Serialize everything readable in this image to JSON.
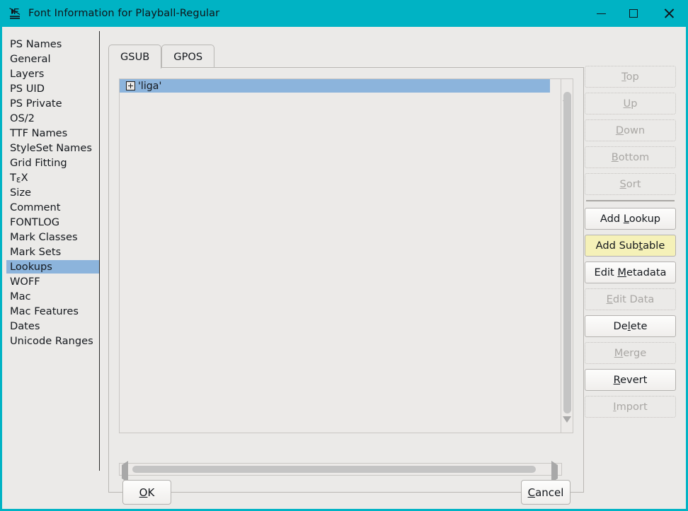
{
  "window": {
    "title": "Font Information for Playball-Regular",
    "icon": "fontforge-icon",
    "accent_color": "#00b3c4",
    "background_color": "#ebeae8",
    "controls": {
      "minimize": "minimize-icon",
      "maximize": "maximize-icon",
      "close": "close-icon"
    }
  },
  "sidebar": {
    "selected": "Lookups",
    "selection_color": "#8cb4dc",
    "items": [
      {
        "label": "PS Names"
      },
      {
        "label": "General"
      },
      {
        "label": "Layers"
      },
      {
        "label": "PS UID"
      },
      {
        "label": "PS Private"
      },
      {
        "label": "OS/2"
      },
      {
        "label": "TTF Names"
      },
      {
        "label": "StyleSet Names"
      },
      {
        "label": "Grid Fitting"
      },
      {
        "label": "TeX",
        "special": "tex-logo"
      },
      {
        "label": "Size"
      },
      {
        "label": "Comment"
      },
      {
        "label": "FONTLOG"
      },
      {
        "label": "Mark Classes"
      },
      {
        "label": "Mark Sets"
      },
      {
        "label": "Lookups"
      },
      {
        "label": "WOFF"
      },
      {
        "label": "Mac"
      },
      {
        "label": "Mac Features"
      },
      {
        "label": "Dates"
      },
      {
        "label": "Unicode Ranges"
      }
    ]
  },
  "main": {
    "tabs": [
      {
        "label": "GSUB",
        "active": true
      },
      {
        "label": "GPOS",
        "active": false
      }
    ],
    "lookup_list": {
      "rows": [
        {
          "label": "'liga'",
          "expander": "plus-box-icon",
          "selected": true
        }
      ]
    },
    "scrollbars": {
      "vertical": {
        "up": "scroll-up-arrow",
        "down": "scroll-down-arrow"
      },
      "horizontal": {
        "left": "scroll-left-arrow",
        "right": "scroll-right-arrow"
      }
    }
  },
  "buttons": {
    "order": [
      {
        "label": "Top",
        "mnemonic": "T",
        "rest": "op",
        "pre": "",
        "state": "disabled"
      },
      {
        "label": "Up",
        "mnemonic": "U",
        "rest": "p",
        "pre": "",
        "state": "disabled"
      },
      {
        "label": "Down",
        "mnemonic": "D",
        "rest": "own",
        "pre": "",
        "state": "disabled"
      },
      {
        "label": "Bottom",
        "mnemonic": "B",
        "rest": "ottom",
        "pre": "",
        "state": "disabled"
      },
      {
        "label": "Sort",
        "mnemonic": "S",
        "rest": "ort",
        "pre": "",
        "state": "disabled"
      }
    ],
    "actions": [
      {
        "label": "Add Lookup",
        "pre": "Add ",
        "mnemonic": "L",
        "rest": "ookup",
        "state": "enabled"
      },
      {
        "label": "Add Subtable",
        "pre": "Add Sub",
        "mnemonic": "t",
        "rest": "able",
        "state": "hover"
      },
      {
        "label": "Edit Metadata",
        "pre": "Edit ",
        "mnemonic": "M",
        "rest": "etadata",
        "state": "enabled"
      },
      {
        "label": "Edit Data",
        "pre": "",
        "mnemonic": "E",
        "rest": "dit Data",
        "state": "disabled"
      },
      {
        "label": "Delete",
        "pre": "De",
        "mnemonic": "l",
        "rest": "ete",
        "state": "enabled"
      },
      {
        "label": "Merge",
        "pre": "",
        "mnemonic": "M",
        "rest": "erge",
        "state": "disabled"
      },
      {
        "label": "Revert",
        "pre": "",
        "mnemonic": "R",
        "rest": "evert",
        "state": "enabled"
      },
      {
        "label": "Import",
        "pre": "",
        "mnemonic": "I",
        "rest": "mport",
        "state": "disabled"
      }
    ],
    "ok": {
      "pre": "",
      "mnemonic": "O",
      "rest": "K"
    },
    "cancel": {
      "pre": "",
      "mnemonic": "C",
      "rest": "ancel"
    }
  }
}
